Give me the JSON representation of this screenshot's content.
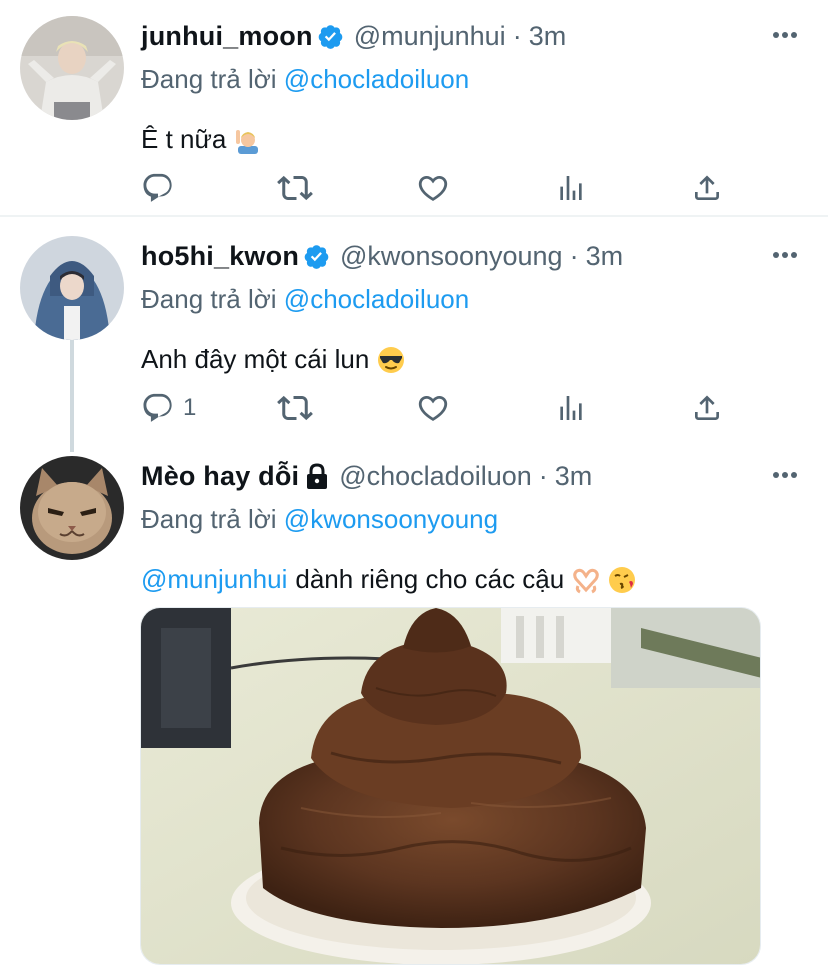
{
  "tweets": [
    {
      "display_name": "junhui_moon",
      "handle": "@munjunhui",
      "dot": "·",
      "time": "3m",
      "replying_prefix": "Đang trả lời",
      "replying_to": "@chocladoiluon",
      "text": "Ê t nữa",
      "emoji": "person-raising-hand-emoji",
      "reply_count": ""
    },
    {
      "display_name": "ho5hi_kwon",
      "handle": "@kwonsoonyoung",
      "dot": "·",
      "time": "3m",
      "replying_prefix": "Đang trả lời",
      "replying_to": "@chocladoiluon",
      "text": "Anh đây một cái lun",
      "emoji": "sunglasses-emoji",
      "reply_count": "1"
    },
    {
      "display_name": "Mèo hay dỗi",
      "handle": "@chocladoiluon",
      "dot": "·",
      "time": "3m",
      "replying_prefix": "Đang trả lời",
      "replying_to": "@kwonsoonyoung",
      "mention": "@munjunhui",
      "text": "dành riêng cho các cậu",
      "emoji": "heart-hands-and-kiss-emoji",
      "media": "chocolate-cake-photo"
    }
  ],
  "colors": {
    "accent": "#1d9bf0",
    "secondary_text": "#536471",
    "primary_text": "#0f1419",
    "separator": "#eff3f4"
  }
}
